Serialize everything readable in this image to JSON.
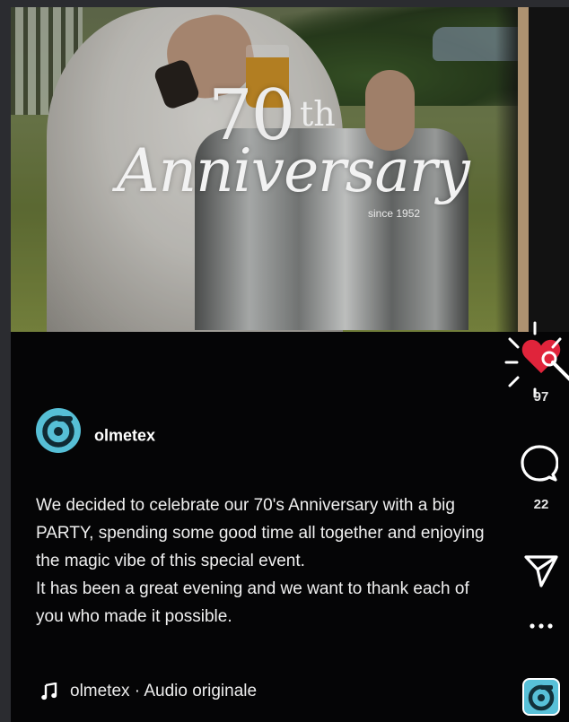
{
  "video": {
    "overlay_number": "70",
    "overlay_suffix": "th",
    "overlay_word": "Anniversary",
    "overlay_since": "since 1952"
  },
  "actions": {
    "like_count": "97",
    "comment_count": "22",
    "icons": [
      "heart-icon",
      "comment-icon",
      "share-icon",
      "more-icon"
    ]
  },
  "author": {
    "username": "olmetex",
    "avatar_color": "#56bfd6"
  },
  "caption": {
    "paragraphs": [
      "We decided to celebrate our 70's Anniversary with a big PARTY, spending some good time all together and enjoying the magic vibe of this special event.",
      "It has been a great evening and we want to thank each of you who made it possible."
    ]
  },
  "audio": {
    "label": "olmetex · Audio originale"
  },
  "colors": {
    "background": "#050506",
    "like_red": "#e0243b",
    "text": "#f0f0f0"
  }
}
